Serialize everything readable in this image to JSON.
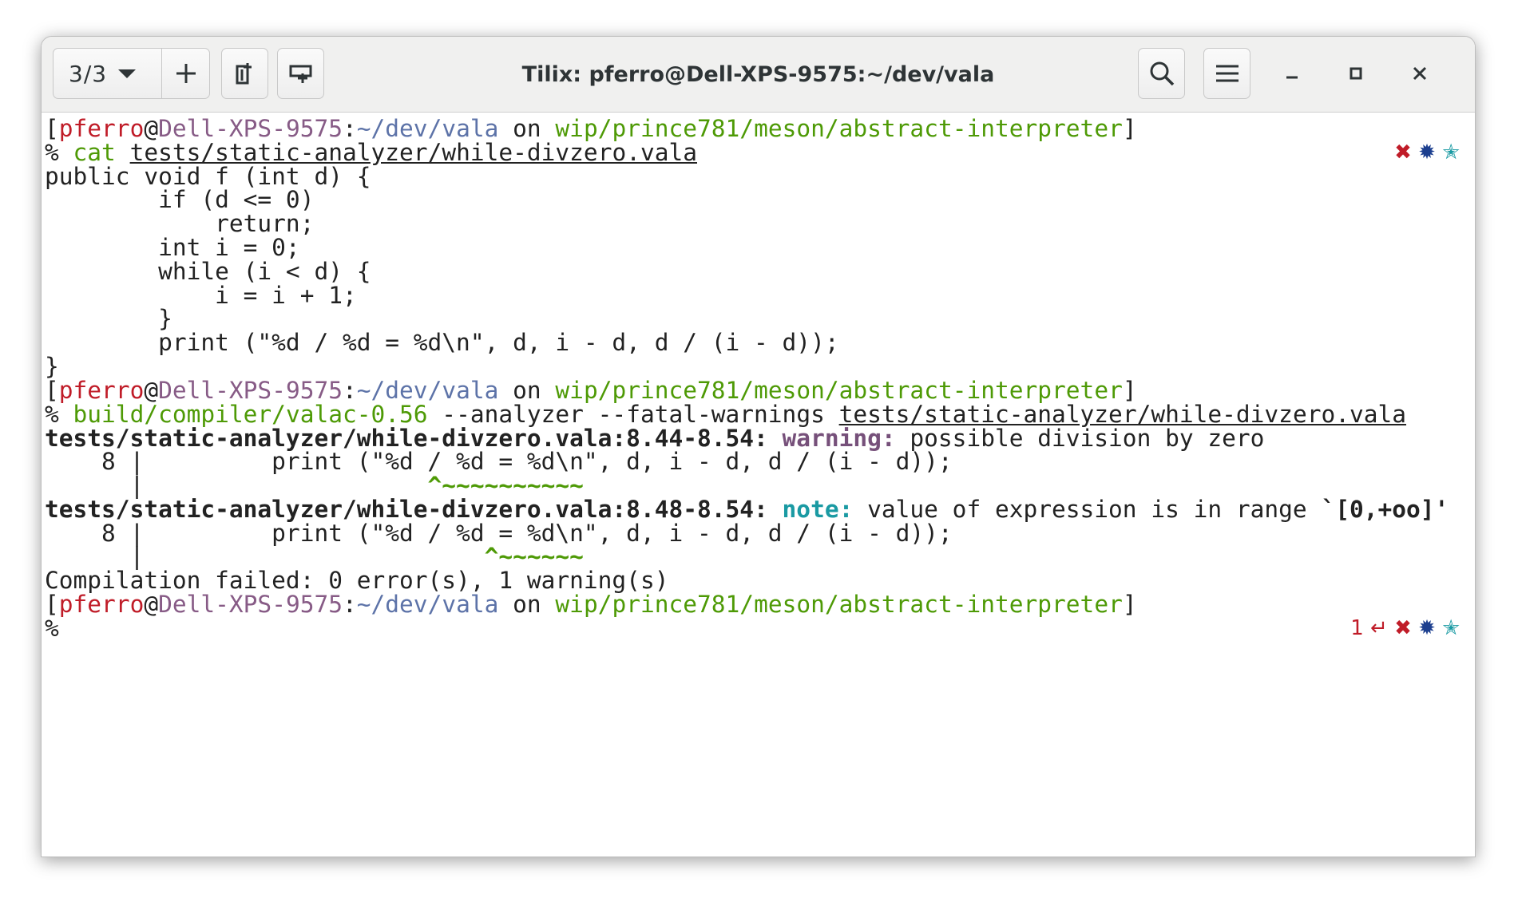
{
  "window": {
    "title": "Tilix: pferro@Dell-XPS-9575:~/dev/vala",
    "session_label": "3/3"
  },
  "icons": {
    "add": "plus-icon",
    "add_right": "add-terminal-right-icon",
    "add_down": "add-terminal-down-icon",
    "search": "search-icon",
    "menu": "hamburger-menu-icon",
    "minimize": "minimize-icon",
    "maximize": "maximize-icon",
    "close": "close-icon"
  },
  "colors": {
    "user": "#c01c28",
    "host": "#875b86",
    "path": "#5d73a8",
    "branch": "#4e9a06",
    "warning": "#76507a",
    "note": "#1a9aa3",
    "star": "#1a9aa3",
    "gear": "#1c3f8f"
  },
  "prompt": {
    "open": "[",
    "user": "pferro",
    "at": "@",
    "host": "Dell-XPS-9575",
    "colon": ":",
    "path": "~/dev/vala",
    "on": " on ",
    "branch": "wip/prince781/meson/abstract-interpreter",
    "close": "]",
    "symbol": "%"
  },
  "commands": {
    "cmd1": "cat",
    "arg1": "tests/static-analyzer/while-divzero.vala",
    "cmd2": "build/compiler/valac-0.56",
    "flags2": " --analyzer --fatal-warnings ",
    "arg2": "tests/static-analyzer/while-divzero.vala"
  },
  "source": [
    "public void f (int d) {",
    "        if (d <= 0)",
    "            return;",
    "        int i = 0;",
    "        while (i < d) {",
    "            i = i + 1;",
    "        }",
    "        print (\"%d / %d = %d\\n\", d, i - d, d / (i - d));",
    "}"
  ],
  "output": {
    "warn_location": "tests/static-analyzer/while-divzero.vala:8.44-8.54: ",
    "warn_label": "warning:",
    "warn_msg": " possible division by zero",
    "src_prefix": "    8 |         ",
    "src_line": "print (\"%d / %d = %d\\n\", d, i - d, d / (i - d));",
    "gutter": "      |",
    "caret1_pad": "                ",
    "caret1_marks": "                    ^~~~~~~~~~~",
    "note_location": "tests/static-analyzer/while-divzero.vala:8.48-8.54: ",
    "note_label": "note:",
    "note_msg": " value of expression is in range ",
    "note_range": "`[0,+oo]'",
    "caret2_marks": "                        ^~~~~~~",
    "summary": "Compilation failed: 0 error(s), 1 warning(s)"
  },
  "status": {
    "exit_code": "1",
    "return_glyph": "↵",
    "x_glyph": "✖",
    "gear_glyph": "✹",
    "star_glyph": "✭"
  }
}
